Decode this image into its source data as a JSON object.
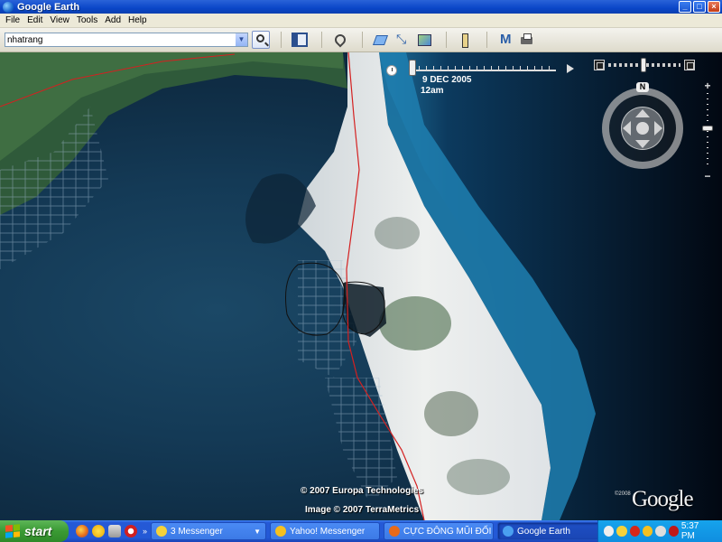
{
  "window": {
    "title": "Google Earth"
  },
  "menu": [
    "File",
    "Edit",
    "View",
    "Tools",
    "Add",
    "Help"
  ],
  "toolbar": {
    "search_value": "nhatrang",
    "icons": [
      "sidebar-icon",
      "placemark-icon",
      "polygon-icon",
      "path-icon",
      "image-overlay-icon",
      "ruler-icon",
      "email-icon",
      "print-icon"
    ]
  },
  "map": {
    "time_date": "9 DEC 2005",
    "time_hour": "12am",
    "nav_north": "N",
    "zoom_plus": "+",
    "zoom_minus": "−",
    "credit_1": "© 2007 Europa Technologies",
    "credit_2": "Image © 2007 TerraMetrics",
    "logo": "Google",
    "logo_copyright": "©2008"
  },
  "taskbar": {
    "start": "start",
    "tasks": [
      {
        "label": "3 Messenger",
        "icon_color": "#f5d23a"
      },
      {
        "label": "Yahoo! Messenger",
        "icon_color": "#f5c020"
      },
      {
        "label": "CỰC ĐÔNG MŨI ĐỐI ...",
        "icon_color": "#e86a1a"
      },
      {
        "label": "Google Earth",
        "icon_color": "#4aa0f0"
      }
    ],
    "clock": "5:37 PM"
  }
}
